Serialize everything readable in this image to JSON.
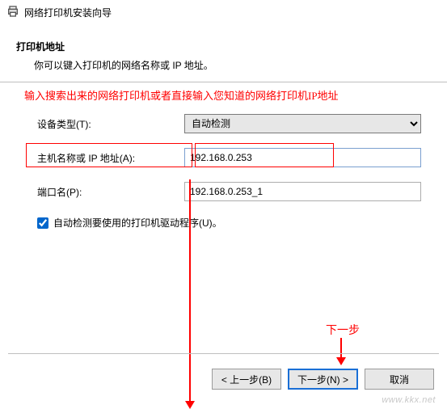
{
  "window": {
    "title": "网络打印机安装向导"
  },
  "header": {
    "title": "打印机地址",
    "subtitle": "你可以键入打印机的网络名称或 IP 地址。"
  },
  "annotation": {
    "main": "输入搜索出来的网络打印机或者直接输入您知道的网络打印机IP地址",
    "next_hint": "下一步"
  },
  "form": {
    "device_type_label": "设备类型(T):",
    "device_type_value": "自动检测",
    "host_label": "主机名称或 IP 地址(A):",
    "host_value": "192.168.0.253",
    "port_label": "端口名(P):",
    "port_value": "192.168.0.253_1",
    "autodetect_label": "自动检测要使用的打印机驱动程序(U)。",
    "autodetect_checked": true
  },
  "buttons": {
    "back": "< 上一步(B)",
    "next": "下一步(N) >",
    "cancel": "取消"
  },
  "watermark": "www.kkx.net"
}
